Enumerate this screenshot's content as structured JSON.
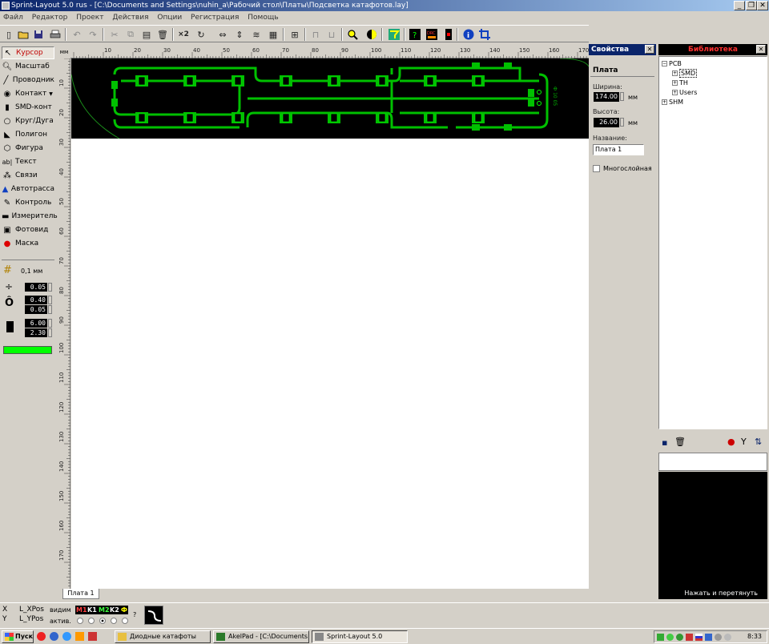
{
  "window": {
    "title": "Sprint-Layout 5.0 rus   - [C:\\Documents and Settings\\nuhin_a\\Рабочий стол\\Платы\\Подсветка катафотов.lay]",
    "min_label": "_",
    "restore_label": "❐",
    "close_label": "✕"
  },
  "menu": [
    "Файл",
    "Редактор",
    "Проект",
    "Действия",
    "Опции",
    "Регистрация",
    "Помощь"
  ],
  "tools": [
    {
      "label": "Курсор",
      "icon": "cursor-icon",
      "selected": true
    },
    {
      "label": "Масштаб",
      "icon": "zoom-icon"
    },
    {
      "label": "Проводник",
      "icon": "track-icon"
    },
    {
      "label": "Контакт",
      "icon": "pad-icon"
    },
    {
      "label": "SMD-конт",
      "icon": "smd-pad-icon"
    },
    {
      "label": "Круг/Дуга",
      "icon": "circle-icon"
    },
    {
      "label": "Полигон",
      "icon": "polygon-icon"
    },
    {
      "label": "Фигура",
      "icon": "shape-icon"
    },
    {
      "label": "Текст",
      "icon": "text-icon"
    },
    {
      "label": "Связи",
      "icon": "connections-icon"
    },
    {
      "label": "Автотрасса",
      "icon": "autoroute-icon"
    },
    {
      "label": "Контроль",
      "icon": "test-icon"
    },
    {
      "label": "Измеритель",
      "icon": "measure-icon"
    },
    {
      "label": "Фотовид",
      "icon": "photoview-icon"
    },
    {
      "label": "Маска",
      "icon": "mask-icon"
    }
  ],
  "grid": {
    "label": "0,1 мм"
  },
  "params": {
    "track_width": "0.05",
    "pad_outer": "0.40",
    "pad_inner": "0.05",
    "smd_width": "6.00",
    "smd_height": "2.30"
  },
  "active_color": "#00ff00",
  "ruler": {
    "unit": "мм",
    "top_labels": [
      "10",
      "20",
      "30",
      "40",
      "50",
      "60",
      "70",
      "80",
      "90",
      "100",
      "110",
      "120",
      "130",
      "140",
      "150",
      "160",
      "170"
    ],
    "left_labels": [
      "10",
      "20",
      "30",
      "40",
      "50",
      "60",
      "70",
      "80",
      "90",
      "100",
      "110",
      "120",
      "130",
      "140",
      "150",
      "160",
      "170"
    ]
  },
  "board": {
    "background": "#000000",
    "copper_color": "#00c000",
    "label_text": "Ф 10 05"
  },
  "tabs": [
    {
      "label": "Плата 1"
    }
  ],
  "properties": {
    "title": "Свойства",
    "section": "Плата",
    "width_label": "Ширина:",
    "width_value": "174.00",
    "width_unit": "мм",
    "height_label": "Высота:",
    "height_value": "26.00",
    "height_unit": "мм",
    "name_label": "Название:",
    "name_value": "Плата 1",
    "multilayer_label": "Многослойная"
  },
  "library": {
    "title": "Библиотека",
    "tree": [
      {
        "label": "PCB",
        "box": "−",
        "level": 0
      },
      {
        "label": "SMD",
        "box": "+",
        "level": 1,
        "selected": true
      },
      {
        "label": "TH",
        "box": "+",
        "level": 1
      },
      {
        "label": "Users",
        "box": "+",
        "level": 1
      },
      {
        "label": "SHM",
        "box": "+",
        "level": 0
      }
    ],
    "hint": "Нажать и перетянуть"
  },
  "status": {
    "x_label": "X",
    "y_label": "Y",
    "x_value": "L_XPos",
    "y_value": "L_YPos",
    "visible_label": "видим",
    "active_label": "актив.",
    "help_label": "?",
    "layers": [
      {
        "label": "M1",
        "color": "#ff4040"
      },
      {
        "label": "K1",
        "color": "#ffffff"
      },
      {
        "label": "M2",
        "color": "#40ff40"
      },
      {
        "label": "K2",
        "color": "#ffffff"
      },
      {
        "label": "Ф",
        "color": "#ffff00"
      }
    ]
  },
  "taskbar": {
    "start": "Пуск",
    "items": [
      {
        "label": "Диодные катафоты"
      },
      {
        "label": "AkelPad - [C:\\Documents..."
      },
      {
        "label": "Sprint-Layout 5.0"
      }
    ],
    "clock": "8:33"
  }
}
